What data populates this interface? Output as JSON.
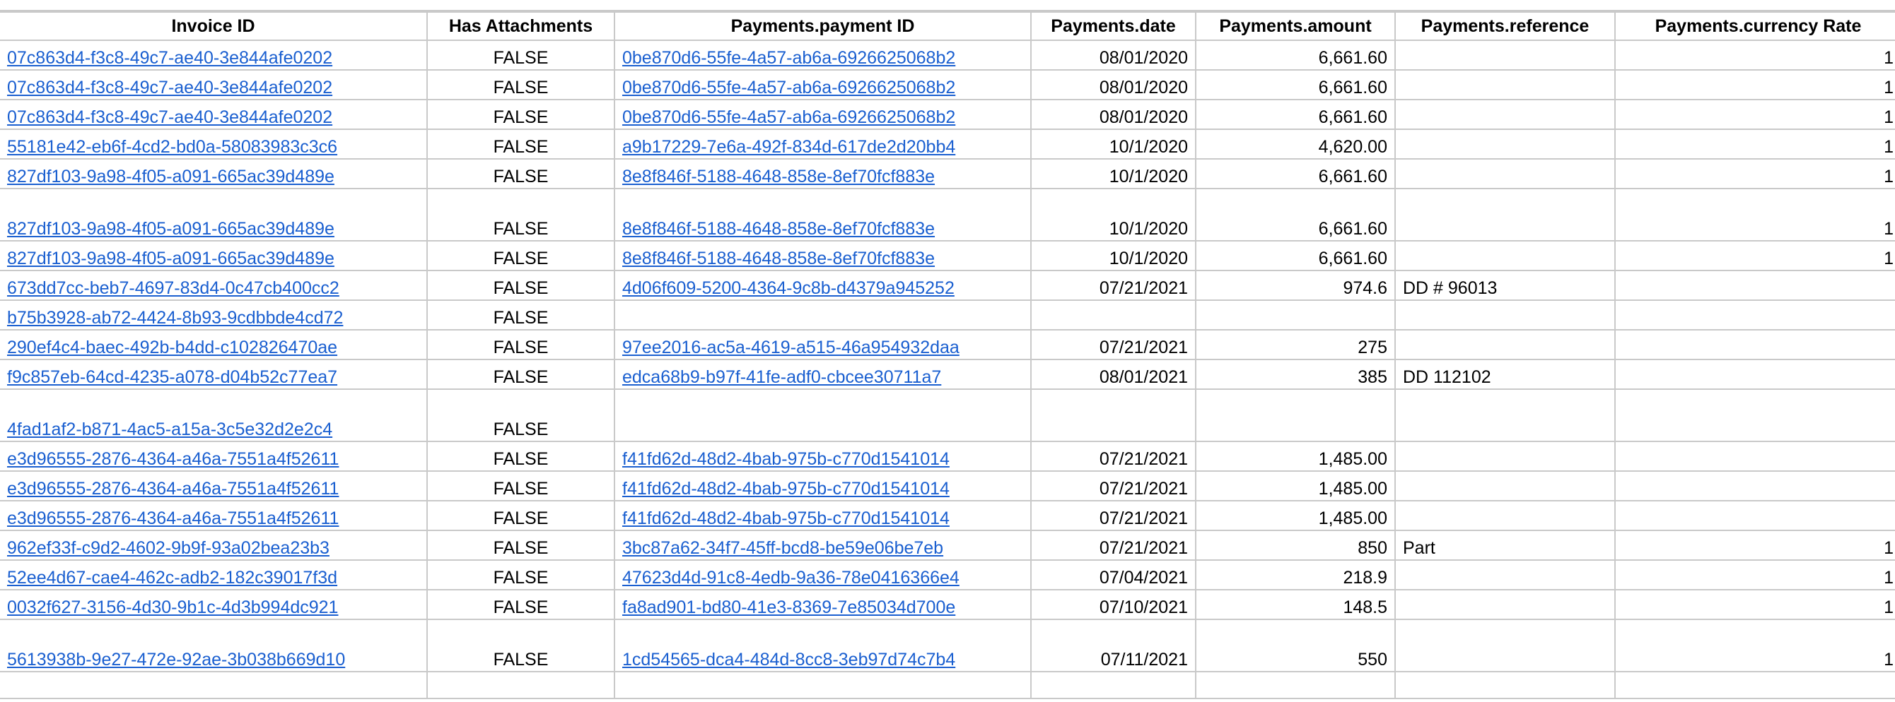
{
  "columns": [
    "Invoice ID",
    "Has Attachments",
    "Payments.payment ID",
    "Payments.date",
    "Payments.amount",
    "Payments.reference",
    "Payments.currency Rate"
  ],
  "rows": [
    {
      "invoice_id": "07c863d4-f3c8-49c7-ae40-3e844afe0202",
      "has_attachments": "FALSE",
      "payment_id": "0be870d6-55fe-4a57-ab6a-6926625068b2",
      "date": "08/01/2020",
      "amount": "6,661.60",
      "reference": "",
      "currency_rate": "1"
    },
    {
      "invoice_id": "07c863d4-f3c8-49c7-ae40-3e844afe0202",
      "has_attachments": "FALSE",
      "payment_id": "0be870d6-55fe-4a57-ab6a-6926625068b2",
      "date": "08/01/2020",
      "amount": "6,661.60",
      "reference": "",
      "currency_rate": "1"
    },
    {
      "invoice_id": "07c863d4-f3c8-49c7-ae40-3e844afe0202",
      "has_attachments": "FALSE",
      "payment_id": "0be870d6-55fe-4a57-ab6a-6926625068b2",
      "date": "08/01/2020",
      "amount": "6,661.60",
      "reference": "",
      "currency_rate": "1"
    },
    {
      "invoice_id": "55181e42-eb6f-4cd2-bd0a-58083983c3c6",
      "has_attachments": "FALSE",
      "payment_id": "a9b17229-7e6a-492f-834d-617de2d20bb4",
      "date": "10/1/2020",
      "amount": "4,620.00",
      "reference": "",
      "currency_rate": "1"
    },
    {
      "invoice_id": "827df103-9a98-4f05-a091-665ac39d489e",
      "has_attachments": "FALSE",
      "payment_id": "8e8f846f-5188-4648-858e-8ef70fcf883e",
      "date": "10/1/2020",
      "amount": "6,661.60",
      "reference": "",
      "currency_rate": "1"
    },
    {
      "invoice_id": "827df103-9a98-4f05-a091-665ac39d489e",
      "has_attachments": "FALSE",
      "payment_id": "8e8f846f-5188-4648-858e-8ef70fcf883e",
      "date": "10/1/2020",
      "amount": "6,661.60",
      "reference": "",
      "currency_rate": "1"
    },
    {
      "invoice_id": "827df103-9a98-4f05-a091-665ac39d489e",
      "has_attachments": "FALSE",
      "payment_id": "8e8f846f-5188-4648-858e-8ef70fcf883e",
      "date": "10/1/2020",
      "amount": "6,661.60",
      "reference": "",
      "currency_rate": "1"
    },
    {
      "invoice_id": "673dd7cc-beb7-4697-83d4-0c47cb400cc2",
      "has_attachments": "FALSE",
      "payment_id": "4d06f609-5200-4364-9c8b-d4379a945252",
      "date": "07/21/2021",
      "amount": "974.6",
      "reference": "DD # 96013",
      "currency_rate": ""
    },
    {
      "invoice_id": "b75b3928-ab72-4424-8b93-9cdbbde4cd72",
      "has_attachments": "FALSE",
      "payment_id": "",
      "date": "",
      "amount": "",
      "reference": "",
      "currency_rate": ""
    },
    {
      "invoice_id": "290ef4c4-baec-492b-b4dd-c102826470ae",
      "has_attachments": "FALSE",
      "payment_id": "97ee2016-ac5a-4619-a515-46a954932daa",
      "date": "07/21/2021",
      "amount": "275",
      "reference": "",
      "currency_rate": ""
    },
    {
      "invoice_id": "f9c857eb-64cd-4235-a078-d04b52c77ea7",
      "has_attachments": "FALSE",
      "payment_id": "edca68b9-b97f-41fe-adf0-cbcee30711a7",
      "date": "08/01/2021",
      "amount": "385",
      "reference": "DD 112102",
      "currency_rate": ""
    },
    {
      "invoice_id": "4fad1af2-b871-4ac5-a15a-3c5e32d2e2c4",
      "has_attachments": "FALSE",
      "payment_id": "",
      "date": "",
      "amount": "",
      "reference": "",
      "currency_rate": ""
    },
    {
      "invoice_id": "e3d96555-2876-4364-a46a-7551a4f52611",
      "has_attachments": "FALSE",
      "payment_id": "f41fd62d-48d2-4bab-975b-c770d1541014",
      "date": "07/21/2021",
      "amount": "1,485.00",
      "reference": "",
      "currency_rate": ""
    },
    {
      "invoice_id": "e3d96555-2876-4364-a46a-7551a4f52611",
      "has_attachments": "FALSE",
      "payment_id": "f41fd62d-48d2-4bab-975b-c770d1541014",
      "date": "07/21/2021",
      "amount": "1,485.00",
      "reference": "",
      "currency_rate": ""
    },
    {
      "invoice_id": "e3d96555-2876-4364-a46a-7551a4f52611",
      "has_attachments": "FALSE",
      "payment_id": "f41fd62d-48d2-4bab-975b-c770d1541014",
      "date": "07/21/2021",
      "amount": "1,485.00",
      "reference": "",
      "currency_rate": ""
    },
    {
      "invoice_id": "962ef33f-c9d2-4602-9b9f-93a02bea23b3",
      "has_attachments": "FALSE",
      "payment_id": "3bc87a62-34f7-45ff-bcd8-be59e06be7eb",
      "date": "07/21/2021",
      "amount": "850",
      "reference": "Part",
      "currency_rate": "1"
    },
    {
      "invoice_id": "52ee4d67-cae4-462c-adb2-182c39017f3d",
      "has_attachments": "FALSE",
      "payment_id": "47623d4d-91c8-4edb-9a36-78e0416366e4",
      "date": "07/04/2021",
      "amount": "218.9",
      "reference": "",
      "currency_rate": "1"
    },
    {
      "invoice_id": "0032f627-3156-4d30-9b1c-4d3b994dc921",
      "has_attachments": "FALSE",
      "payment_id": "fa8ad901-bd80-41e3-8369-7e85034d700e",
      "date": "07/10/2021",
      "amount": "148.5",
      "reference": "",
      "currency_rate": "1"
    },
    {
      "invoice_id": "5613938b-9e27-472e-92ae-3b038b669d10",
      "has_attachments": "FALSE",
      "payment_id": "1cd54565-dca4-484d-8cc8-3eb97d74c7b4",
      "date": "07/11/2021",
      "amount": "550",
      "reference": "",
      "currency_rate": "1"
    }
  ]
}
